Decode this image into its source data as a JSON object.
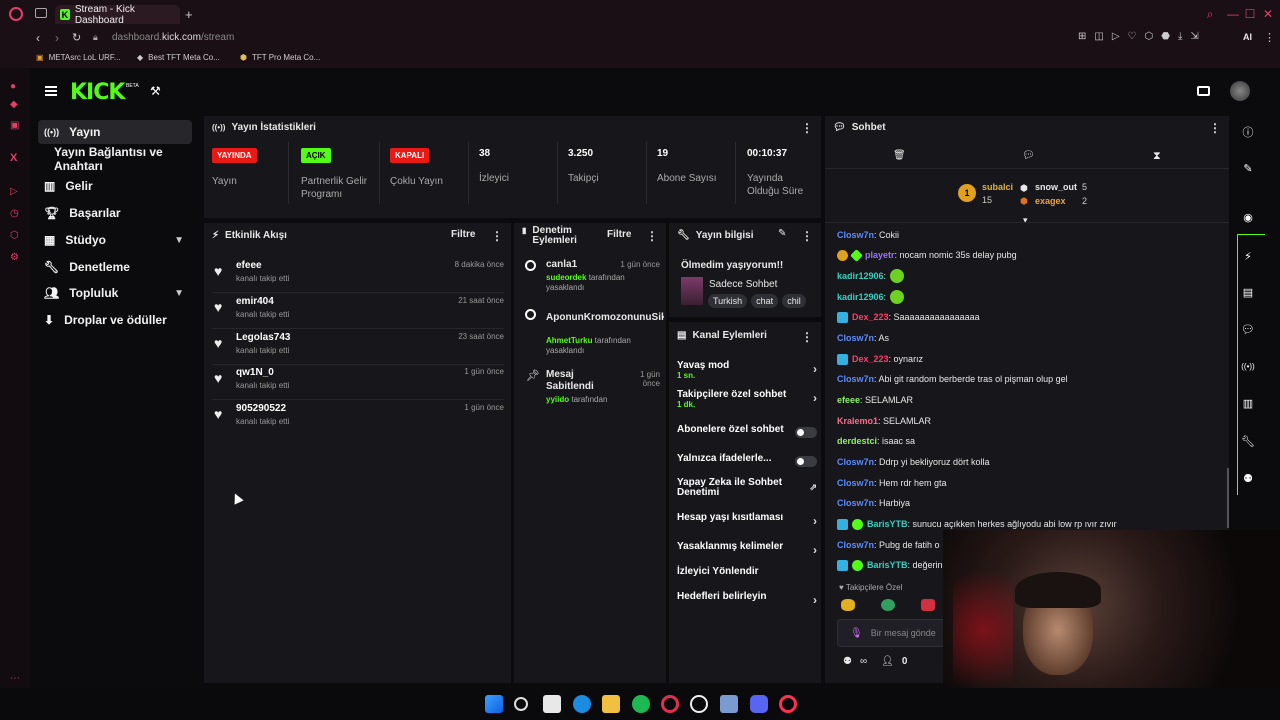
{
  "browser": {
    "tab_title": "Stream - Kick Dashboard",
    "tab_icon": "K",
    "new_tab": "+",
    "url_domain": "dashboard.",
    "url_host": "kick.com",
    "url_path": "/stream",
    "bookmarks": [
      "METAsrc LoL URF...",
      "Best TFT Meta Co...",
      "TFT Pro Meta Co..."
    ],
    "ai_label": "AI"
  },
  "sidebar": {
    "items": [
      {
        "label": "Yayın"
      },
      {
        "label": "Yayın Bağlantısı ve Anahtarı"
      },
      {
        "label": "Gelir"
      },
      {
        "label": "Başarılar"
      },
      {
        "label": "Stüdyo"
      },
      {
        "label": "Denetleme"
      },
      {
        "label": "Topluluk"
      },
      {
        "label": "Droplar ve ödüller"
      }
    ]
  },
  "stats": {
    "title": "Yayın İstatistikleri",
    "cols": [
      {
        "value": "YAYINDA",
        "label": "Yayın"
      },
      {
        "value": "AÇIK",
        "label": "Partnerlik Gelir Programı"
      },
      {
        "value": "KAPALI",
        "label": "Çoklu Yayın"
      },
      {
        "value": "38",
        "label": "İzleyici"
      },
      {
        "value": "3.250",
        "label": "Takipçi"
      },
      {
        "value": "19",
        "label": "Abone Sayısı"
      },
      {
        "value": "00:10:37",
        "label": "Yayında Olduğu Süre"
      }
    ]
  },
  "activity": {
    "title": "Etkinlik Akışı",
    "filter": "Filtre",
    "rows": [
      {
        "name": "efeee",
        "sub": "kanalı takip etti",
        "time": "8 dakika önce"
      },
      {
        "name": "emir404",
        "sub": "kanalı takip etti",
        "time": "21 saat önce"
      },
      {
        "name": "Legolas743",
        "sub": "kanalı takip etti",
        "time": "23 saat önce"
      },
      {
        "name": "qw1N_0",
        "sub": "kanalı takip etti",
        "time": "1 gün önce"
      },
      {
        "name": "905290522",
        "sub": "kanalı takip etti",
        "time": "1 gün önce"
      }
    ]
  },
  "moderation": {
    "title": "Denetim Eylemleri",
    "filter": "Filtre",
    "rows": [
      {
        "name": "canla1",
        "time": "1 gün önce",
        "by": "sudeordek",
        "by_suffix": "tarafından",
        "action": "yasaklandı"
      },
      {
        "name": "AponunKromozonunuSik",
        "time": "",
        "by": "AhmetTurku",
        "by_suffix": "tarafından",
        "action": "yasaklandı"
      },
      {
        "name": "Mesaj Sabitlendi",
        "time": "1 gün önce",
        "by": "yyiido",
        "by_suffix": "tarafından",
        "action": ""
      }
    ]
  },
  "stream_info": {
    "title": "Yayın bilgisi",
    "stream_title": "Ölmedim yaşıyorum!!",
    "category": "Sadece Sohbet",
    "tags": [
      "Turkish",
      "chat",
      "chil"
    ]
  },
  "channel_actions": {
    "title": "Kanal Eylemleri",
    "items": [
      {
        "label": "Yavaş mod",
        "sub": "1 sn.",
        "control": "arrow"
      },
      {
        "label": "Takipçilere özel sohbet",
        "sub": "1 dk.",
        "control": "arrow"
      },
      {
        "label": "Abonelere özel sohbet",
        "sub": "",
        "control": "toggle"
      },
      {
        "label": "Yalnızca ifadelerle...",
        "sub": "",
        "control": "toggle"
      },
      {
        "label": "Yapay Zeka ile Sohbet Denetimi",
        "sub": "",
        "control": "external"
      },
      {
        "label": "Hesap yaşı kısıtlaması",
        "sub": "",
        "control": "arrow"
      },
      {
        "label": "Yasaklanmış kelimeler",
        "sub": "",
        "control": "arrow"
      },
      {
        "label": "İzleyici Yönlendir",
        "sub": "",
        "control": "none"
      },
      {
        "label": "Hedefleri belirleyin",
        "sub": "",
        "control": "arrow"
      }
    ]
  },
  "chat": {
    "title": "Sohbet",
    "leaderboard": [
      {
        "rank": "1",
        "name": "subalci",
        "count": "15"
      },
      {
        "name": "snow_out",
        "count": "5"
      },
      {
        "name": "exagex",
        "count": "2"
      }
    ],
    "messages": [
      {
        "user": "Closw7n",
        "color": "blue",
        "text": ": Cokii"
      },
      {
        "user": "playetr",
        "color": "purple",
        "text": ": nocam nomic 35s delay pubg"
      },
      {
        "user": "kadir12906",
        "color": "teal",
        "text": ":"
      },
      {
        "user": "kadir12906",
        "color": "teal",
        "text": ":"
      },
      {
        "user": "Dex_223",
        "color": "red",
        "text": ": Saaaaaaaaaaaaaaaa"
      },
      {
        "user": "Closw7n",
        "color": "blue",
        "text": ": As"
      },
      {
        "user": "Dex_223",
        "color": "red",
        "text": ": oynarız"
      },
      {
        "user": "Closw7n",
        "color": "blue",
        "text": ": Abi git random berberde tras ol pişman olup gel"
      },
      {
        "user": "efeee",
        "color": "lgreen",
        "text": ": SELAMLAR"
      },
      {
        "user": "Kralemo1",
        "color": "pink",
        "text": ": SELAMLAR"
      },
      {
        "user": "derdestci",
        "color": "lgreen",
        "text": ": isaac sa"
      },
      {
        "user": "Closw7n",
        "color": "blue",
        "text": ": Ddrp yi bekliyoruz dört kolla"
      },
      {
        "user": "Closw7n",
        "color": "blue",
        "text": ": Hem rdr hem gta"
      },
      {
        "user": "Closw7n",
        "color": "blue",
        "text": ": Harbiya"
      },
      {
        "user": "BarisYTB",
        "color": "teal",
        "text": ": sunucu açıkken herkes ağlıyodu abi low rp ıvır zıvır"
      },
      {
        "user": "Closw7n",
        "color": "blue",
        "text": ": Pubg de fatih o"
      },
      {
        "user": "BarisYTB",
        "color": "teal",
        "text": ": değerin"
      }
    ],
    "followers_only": "Takipçilere Özel",
    "input_placeholder": "Bir mesaj gönde",
    "viewer_count": "0"
  },
  "colors": {
    "accent": "#53fc18",
    "live": "#e91916",
    "bg": "#0b0b0e",
    "panel": "#17171b"
  }
}
